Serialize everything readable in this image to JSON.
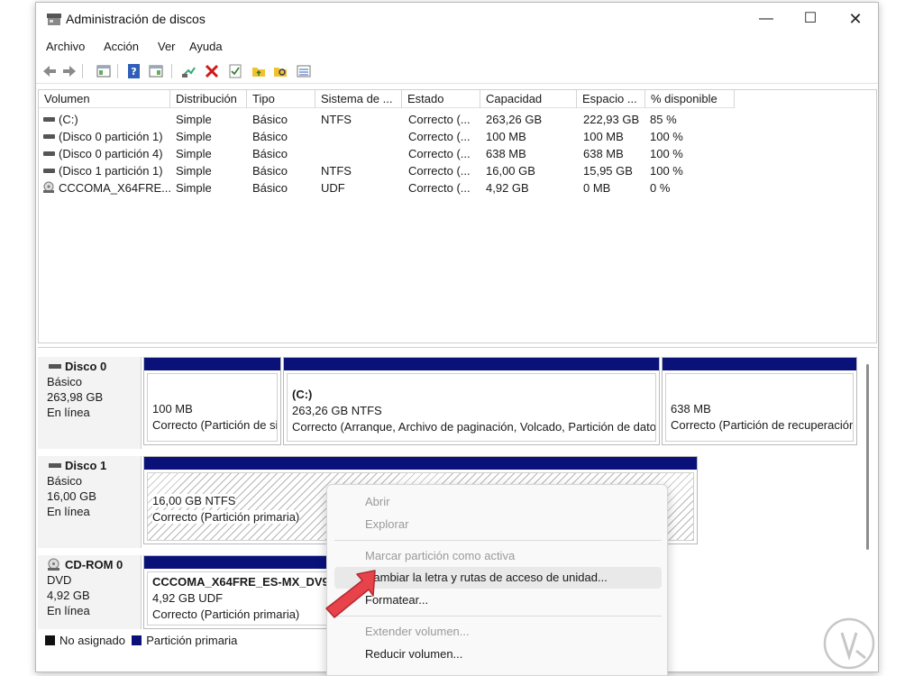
{
  "window": {
    "title": "Administración de discos"
  },
  "menu": [
    "Archivo",
    "Acción",
    "Ver",
    "Ayuda"
  ],
  "columns": [
    "Volumen",
    "Distribución",
    "Tipo",
    "Sistema de ...",
    "Estado",
    "Capacidad",
    "Espacio ...",
    "% disponible"
  ],
  "volumes": [
    {
      "volumen": "(C:)",
      "distribucion": "Simple",
      "tipo": "Básico",
      "sistema": "NTFS",
      "estado": "Correcto (...",
      "capacidad": "263,26 GB",
      "espacio": "222,93 GB",
      "disponible": "85 %",
      "icon": "disk-icon"
    },
    {
      "volumen": "(Disco 0 partición 1)",
      "distribucion": "Simple",
      "tipo": "Básico",
      "sistema": "",
      "estado": "Correcto (...",
      "capacidad": "100 MB",
      "espacio": "100 MB",
      "disponible": "100 %",
      "icon": "disk-icon"
    },
    {
      "volumen": "(Disco 0 partición 4)",
      "distribucion": "Simple",
      "tipo": "Básico",
      "sistema": "",
      "estado": "Correcto (...",
      "capacidad": "638 MB",
      "espacio": "638 MB",
      "disponible": "100 %",
      "icon": "disk-icon"
    },
    {
      "volumen": "(Disco 1 partición 1)",
      "distribucion": "Simple",
      "tipo": "Básico",
      "sistema": "NTFS",
      "estado": "Correcto (...",
      "capacidad": "16,00 GB",
      "espacio": "15,95 GB",
      "disponible": "100 %",
      "icon": "disk-icon"
    },
    {
      "volumen": "CCCOMA_X64FRE...",
      "distribucion": "Simple",
      "tipo": "Básico",
      "sistema": "UDF",
      "estado": "Correcto (...",
      "capacidad": "4,92 GB",
      "espacio": "0 MB",
      "disponible": "0 %",
      "icon": "cd-icon"
    }
  ],
  "disks": [
    {
      "name": "Disco 0",
      "type": "Básico",
      "size": "263,98 GB",
      "status": "En línea",
      "partitions": [
        {
          "title": "",
          "line1": "100 MB",
          "line2": "Correcto (Partición de sistema EFI)"
        },
        {
          "title": "(C:)",
          "line1": "263,26 GB NTFS",
          "line2": "Correcto (Arranque, Archivo de paginación, Volcado, Partición de datos básicos)"
        },
        {
          "title": "",
          "line1": "638 MB",
          "line2": "Correcto (Partición de recuperación)"
        }
      ]
    },
    {
      "name": "Disco 1",
      "type": "Básico",
      "size": "16,00 GB",
      "status": "En línea",
      "partitions": [
        {
          "title": "",
          "line1": "16,00 GB NTFS",
          "line2": "Correcto (Partición primaria)"
        }
      ]
    },
    {
      "name": "CD-ROM 0",
      "type": "DVD",
      "size": "4,92 GB",
      "status": "En línea",
      "partitions": [
        {
          "title": "CCCOMA_X64FRE_ES-MX_DV9",
          "line1": "4,92 GB UDF",
          "line2": "Correcto (Partición primaria)"
        }
      ]
    }
  ],
  "legend": {
    "unallocated": "No asignado",
    "primary": "Partición primaria"
  },
  "context_menu": {
    "items": [
      {
        "label": "Abrir",
        "enabled": false
      },
      {
        "label": "Explorar",
        "enabled": false
      },
      {
        "label": "Marcar partición como activa",
        "enabled": false
      },
      {
        "label": "Cambiar la letra y rutas de acceso de unidad...",
        "enabled": true
      },
      {
        "label": "Formatear...",
        "enabled": true
      },
      {
        "label": "Extender volumen...",
        "enabled": false
      },
      {
        "label": "Reducir volumen...",
        "enabled": true
      }
    ]
  },
  "colors": {
    "partition_bar": "#0a127a",
    "unallocated": "#111111",
    "delete_icon": "#d01818",
    "arrow": "#e8424b"
  }
}
